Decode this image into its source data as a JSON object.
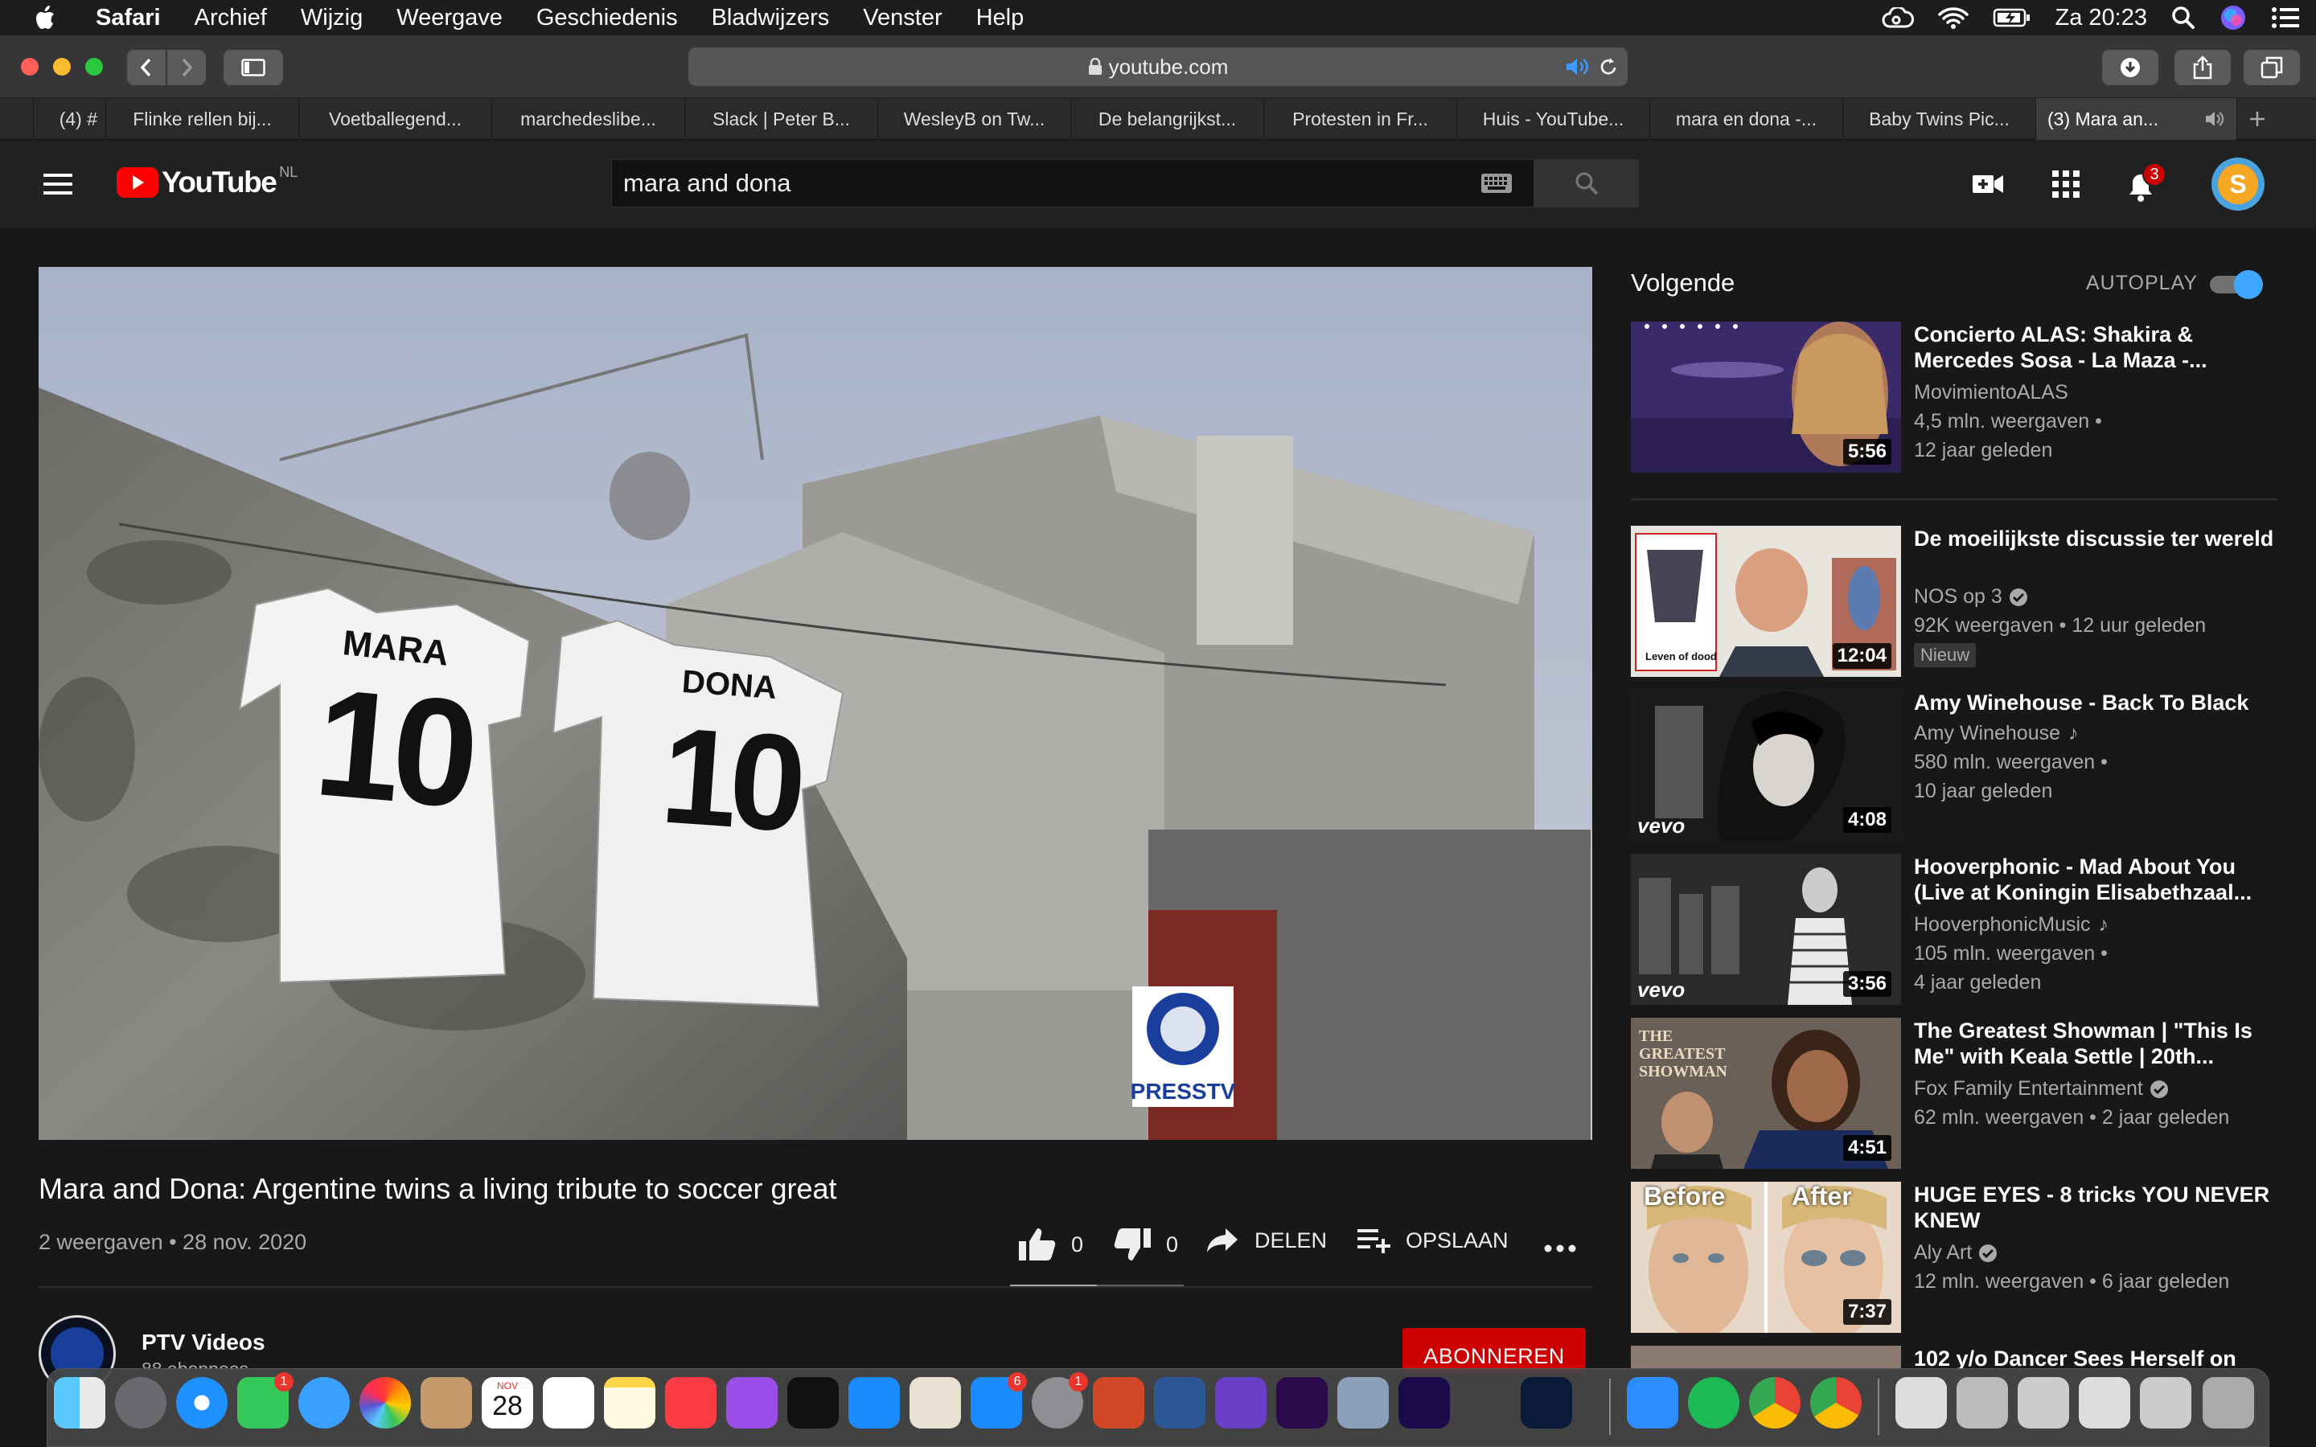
{
  "menubar": {
    "items": [
      "Safari",
      "Archief",
      "Wijzig",
      "Weergave",
      "Geschiedenis",
      "Bladwijzers",
      "Venster",
      "Help"
    ],
    "clock": "Za 20:23"
  },
  "browser": {
    "url": "youtube.com",
    "tabs": [
      "(4) #",
      "Flinke rellen bij...",
      "Voetballegend...",
      "marchedeslibe...",
      "Slack | Peter B...",
      "WesleyB on Tw...",
      "De belangrijkst...",
      "Protesten in Fr...",
      "Huis - YouTube...",
      "mara en dona -...",
      "Baby Twins Pic...",
      "(3) Mara an..."
    ]
  },
  "youtube": {
    "logo_text": "YouTube",
    "region": "NL",
    "search_value": "mara and dona",
    "notification_count": "3",
    "avatar_letter": "S"
  },
  "video": {
    "title": "Mara and Dona: Argentine twins a living tribute to soccer great",
    "views_date": "2 weergaven • 28 nov. 2020",
    "likes": "0",
    "dislikes": "0",
    "share_label": "DELEN",
    "save_label": "OPSLAAN",
    "shirt_left_name": "MARA",
    "shirt_right_name": "DONA",
    "shirt_number": "10",
    "watermark": "PRESSTV",
    "channel_name": "PTV Videos",
    "channel_subs": "88 abonnees",
    "subscribe_label": "ABONNEREN"
  },
  "sidebar": {
    "heading": "Volgende",
    "autoplay_label": "AUTOPLAY",
    "cards": [
      {
        "title": "Concierto ALAS: Shakira & Mercedes Sosa - La Maza -...",
        "channel": "MovimientoALAS",
        "views": "4,5 mln. weergaven •",
        "age": "12 jaar geleden",
        "duration": "5:56"
      },
      {
        "title": "De moeilijkste discussie ter wereld",
        "channel": "NOS op 3",
        "views": "92K weergaven • 12 uur geleden",
        "badge": "Nieuw",
        "duration": "12:04",
        "thumb_label": "Leven of dood"
      },
      {
        "title": "Amy Winehouse - Back To Black",
        "channel": "Amy Winehouse",
        "views": "580 mln. weergaven •",
        "age": "10 jaar geleden",
        "duration": "4:08",
        "thumb_label": "vevo"
      },
      {
        "title": "Hooverphonic - Mad About You (Live at Koningin Elisabethzaal...",
        "channel": "HooverphonicMusic",
        "views": "105 mln. weergaven •",
        "age": "4 jaar geleden",
        "duration": "3:56",
        "thumb_label": "vevo"
      },
      {
        "title": "The Greatest Showman | \"This Is Me\" with Keala Settle | 20th...",
        "channel": "Fox Family Entertainment",
        "views": "62 mln. weergaven • 2 jaar geleden",
        "duration": "4:51",
        "thumb_label": "THE GREATEST SHOWMAN"
      },
      {
        "title": "HUGE EYES - 8 tricks YOU NEVER KNEW",
        "channel": "Aly Art",
        "views": "12 mln. weergaven • 6 jaar geleden",
        "duration": "7:37",
        "thumb_before": "Before",
        "thumb_after": "After"
      },
      {
        "title": "102 y/o Dancer Sees Herself on"
      }
    ]
  },
  "dock": {
    "calendar_month": "NOV",
    "calendar_day": "28",
    "badges": {
      "facetime": "1",
      "appstore": "6",
      "settings": "1"
    }
  }
}
